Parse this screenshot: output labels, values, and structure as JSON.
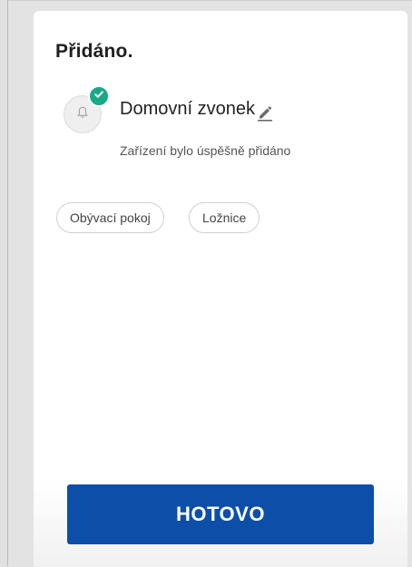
{
  "header": {
    "title": "Přidáno."
  },
  "device": {
    "name": "Domovní zvonek",
    "status_text": "Zařízení bylo úspěšně přidáno",
    "icon": "bell-icon",
    "badge_icon": "check-icon",
    "edit_icon": "pencil-icon"
  },
  "rooms": [
    {
      "label": "Obývací pokoj"
    },
    {
      "label": "Ložnice"
    }
  ],
  "actions": {
    "done_label": "HOTOVO"
  },
  "colors": {
    "primary": "#0d4fa8",
    "success": "#1aa987",
    "card_background": "#ffffff",
    "page_background": "#e3e3e3"
  }
}
